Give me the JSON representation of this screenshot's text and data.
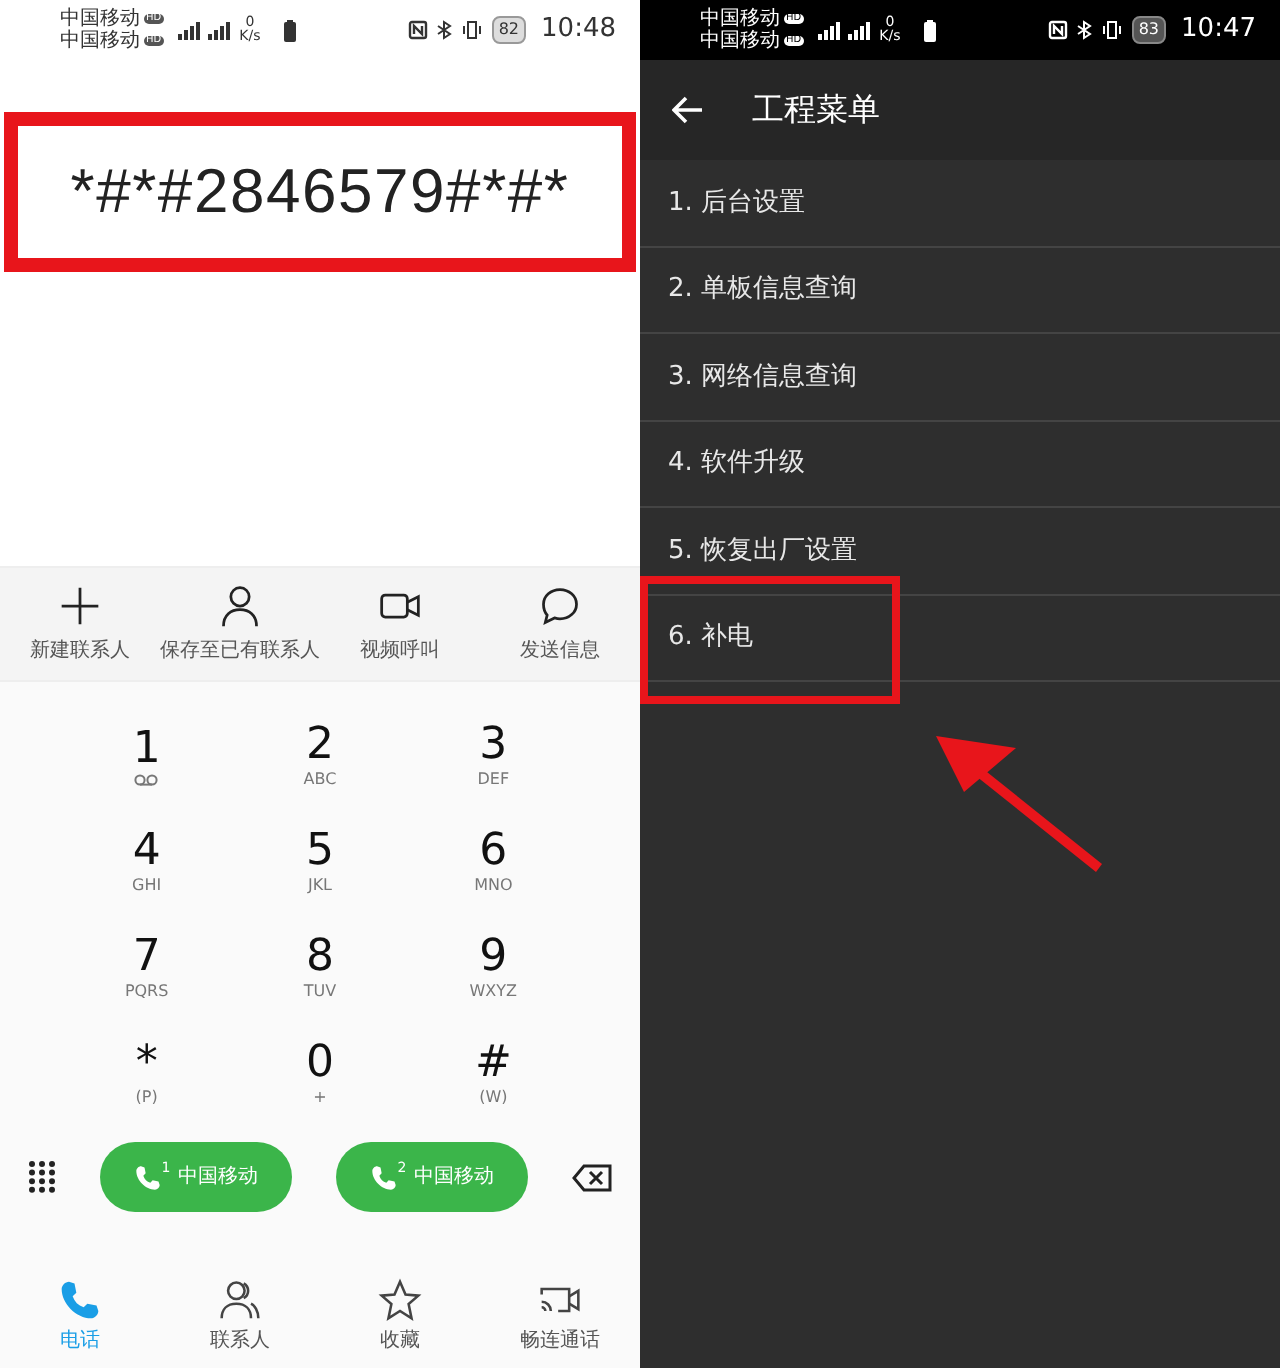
{
  "left_screen": {
    "status_bar": {
      "carriers": [
        {
          "name": "中国移动",
          "badge": "HD"
        },
        {
          "name": "中国移动",
          "badge": "HD"
        }
      ],
      "speed_value": "0",
      "speed_unit": "K/s",
      "battery": "82",
      "time": "10:48"
    },
    "dialed_number": "*#*#2846579#*#*",
    "actions": [
      {
        "kind": "add",
        "label": "新建联系人"
      },
      {
        "kind": "person",
        "label": "保存至已有联系人"
      },
      {
        "kind": "video",
        "label": "视频呼叫"
      },
      {
        "kind": "message",
        "label": "发送信息"
      }
    ],
    "keypad": [
      {
        "digit": "1",
        "kind": "voicemail"
      },
      {
        "digit": "2",
        "letters": "ABC"
      },
      {
        "digit": "3",
        "letters": "DEF"
      },
      {
        "digit": "4",
        "letters": "GHI"
      },
      {
        "digit": "5",
        "letters": "JKL"
      },
      {
        "digit": "6",
        "letters": "MNO"
      },
      {
        "digit": "7",
        "letters": "PQRS"
      },
      {
        "digit": "8",
        "letters": "TUV"
      },
      {
        "digit": "9",
        "letters": "WXYZ"
      },
      {
        "digit": "*",
        "letters": "(P)"
      },
      {
        "digit": "0",
        "letters": "+"
      },
      {
        "digit": "#",
        "letters": "(W)"
      }
    ],
    "call_buttons": [
      {
        "sim": "1",
        "label": "中国移动"
      },
      {
        "sim": "2",
        "label": "中国移动"
      }
    ],
    "bottom_nav": [
      {
        "kind": "phone",
        "label": "电话",
        "selected": true
      },
      {
        "kind": "contacts",
        "label": "联系人",
        "selected": false
      },
      {
        "kind": "star",
        "label": "收藏",
        "selected": false
      },
      {
        "kind": "cast",
        "label": "畅连通话",
        "selected": false
      }
    ]
  },
  "right_screen": {
    "status_bar": {
      "carriers": [
        {
          "name": "中国移动",
          "badge": "HD"
        },
        {
          "name": "中国移动",
          "badge": "HD"
        }
      ],
      "speed_value": "0",
      "speed_unit": "K/s",
      "battery": "83",
      "time": "10:47"
    },
    "title": "工程菜单",
    "menu_items": [
      {
        "label": "1. 后台设置",
        "highlighted": false
      },
      {
        "label": "2. 单板信息查询",
        "highlighted": false
      },
      {
        "label": "3. 网络信息查询",
        "highlighted": false
      },
      {
        "label": "4. 软件升级",
        "highlighted": false
      },
      {
        "label": "5. 恢复出厂设置",
        "highlighted": false
      },
      {
        "label": "6. 补电",
        "highlighted": true
      }
    ]
  }
}
